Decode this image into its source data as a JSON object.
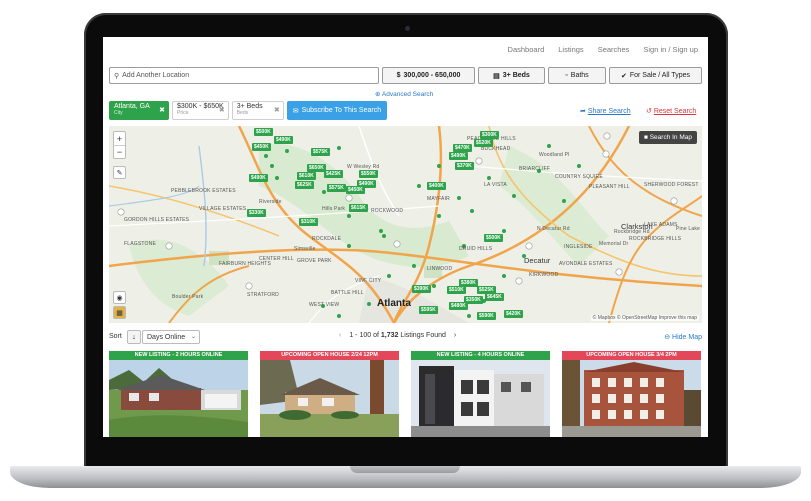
{
  "nav": {
    "dashboard": "Dashboard",
    "listings": "Listings",
    "searches": "Searches",
    "signin": "Sign in / Sign up"
  },
  "search": {
    "location_placeholder": "Add Another Location",
    "price": "300,000 - 650,000",
    "beds": "3+ Beds",
    "baths": "Baths",
    "sale_type": "For Sale / All Types",
    "advanced": "Advanced Search"
  },
  "chips": [
    {
      "label": "Atlanta, GA",
      "sub": "City"
    },
    {
      "label": "$300K - $650K",
      "sub": "Price"
    },
    {
      "label": "3+ Beds",
      "sub": "Beds"
    }
  ],
  "actions": {
    "subscribe": "Subscribe To This Search",
    "share": "Share Search",
    "reset": "Reset Search"
  },
  "map": {
    "search_in_map": "Search In Map",
    "attribution": "© Mapbox © OpenStreetMap Improve this map",
    "city_label": "Atlanta",
    "areas": [
      "BUCKHEAD",
      "PEACHTREE HILLS",
      "LA VISTA",
      "PLEASANT HILL",
      "SHERWOOD FOREST",
      "PEBBLEBROOK ESTATES",
      "GORDON HILLS ESTATES",
      "VILLAGE ESTATES",
      "FLAGSTONE",
      "FAIRBURN HEIGHTS",
      "CENTER HILL",
      "GROVE PARK",
      "STRATFORD",
      "BATTLE HILL",
      "ROCKDALE",
      "KIRKWOOD",
      "INGLESIDE",
      "AVONDALE ESTATES",
      "COUNTRY SQUIRE",
      "BRIARCLIFF",
      "MAYFAIR",
      "ROCKWOOD",
      "DRUID HILLS",
      "LAKE ADAMS",
      "ROCKBRIDGE HILLS",
      "WEST VIEW",
      "VINE CITY",
      "LINWOOD"
    ],
    "towns": [
      "Clarkston",
      "Decatur",
      "Riverside",
      "Simsville",
      "Hills Park",
      "Boulder Park",
      "W Wesley Rd",
      "Rockbridge Rd",
      "Pine Lake",
      "Memorial Dr",
      "N Decatur Rd",
      "Woodland Pl"
    ],
    "price_pins": [
      "$500K",
      "$490K",
      "$450K",
      "$575K",
      "$650K",
      "$610K",
      "$425K",
      "$625K",
      "$550K",
      "$490K",
      "$615K",
      "$575K",
      "$330K",
      "$490K",
      "$450K",
      "$470K",
      "$520K",
      "$490K",
      "$300K",
      "$370K",
      "$400K",
      "$310K",
      "$500K",
      "$390K",
      "$380K",
      "$525K",
      "$645K",
      "$510K",
      "$350K",
      "$480K",
      "$595K",
      "$420K",
      "$590K"
    ]
  },
  "sort": {
    "label": "Sort",
    "value": "Days Online"
  },
  "pagination": {
    "range": "1 - 100 of",
    "total": "1,732",
    "suffix": "Listings Found",
    "hide_map": "Hide Map"
  },
  "listings": [
    {
      "banner": "NEW LISTING - 2 HOURS ONLINE",
      "type": "new"
    },
    {
      "banner": "UPCOMING OPEN HOUSE 2/24 12PM",
      "type": "open"
    },
    {
      "banner": "NEW LISTING - 4 HOURS ONLINE",
      "type": "new"
    },
    {
      "banner": "UPCOMING OPEN HOUSE 3/4 2PM",
      "type": "open"
    }
  ],
  "colors": {
    "accent_green": "#2fa34b",
    "accent_blue": "#3aa1e6",
    "link_blue": "#2a78c5",
    "reset_red": "#d9363e",
    "open_house_red": "#e2475a"
  }
}
